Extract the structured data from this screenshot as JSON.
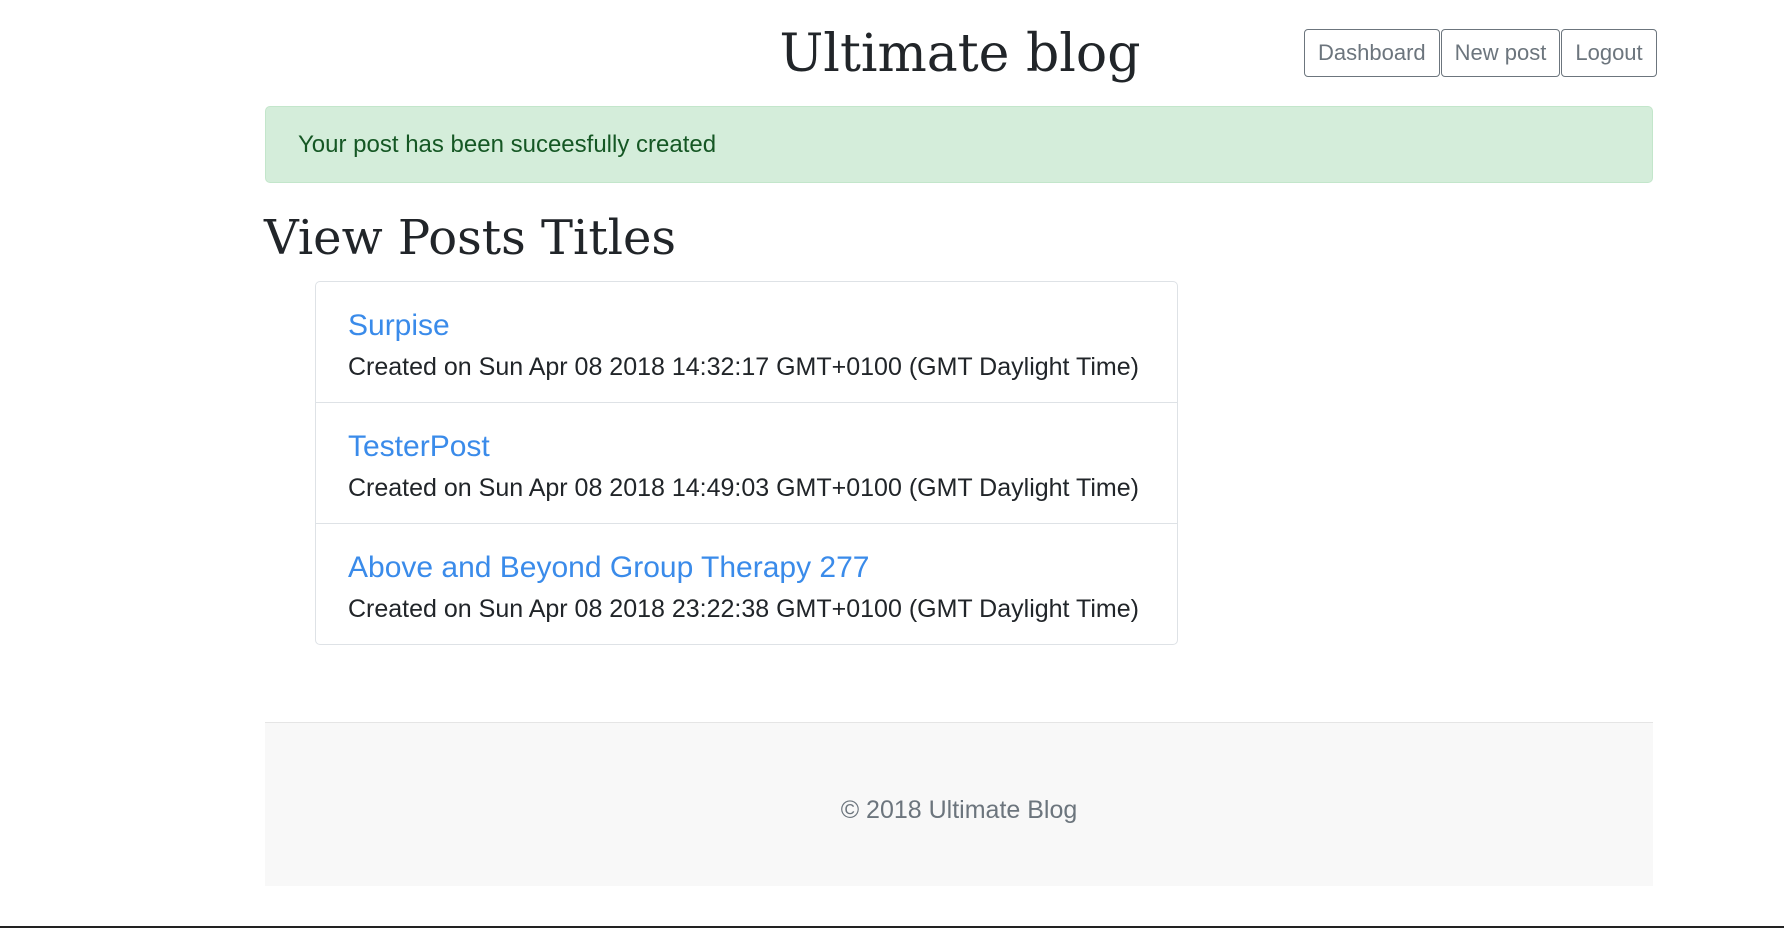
{
  "header": {
    "title": "Ultimate blog",
    "nav": [
      {
        "label": "Dashboard"
      },
      {
        "label": "New post"
      },
      {
        "label": "Logout"
      }
    ]
  },
  "alert": {
    "message": "Your post has been suceesfully created",
    "color": "#d4edda"
  },
  "main": {
    "heading": "View Posts Titles",
    "posts": [
      {
        "title": "Surpise",
        "created": "Created on Sun Apr 08 2018 14:32:17 GMT+0100 (GMT Daylight Time)"
      },
      {
        "title": "TesterPost",
        "created": "Created on Sun Apr 08 2018 14:49:03 GMT+0100 (GMT Daylight Time)"
      },
      {
        "title": "Above and Beyond Group Therapy 277",
        "created": "Created on Sun Apr 08 2018 23:22:38 GMT+0100 (GMT Daylight Time)"
      }
    ]
  },
  "footer": {
    "text": "© 2018 Ultimate Blog"
  },
  "colors": {
    "link": "#3a8bea",
    "alert_text": "#155724",
    "footer_bg": "#f8f8f8"
  }
}
